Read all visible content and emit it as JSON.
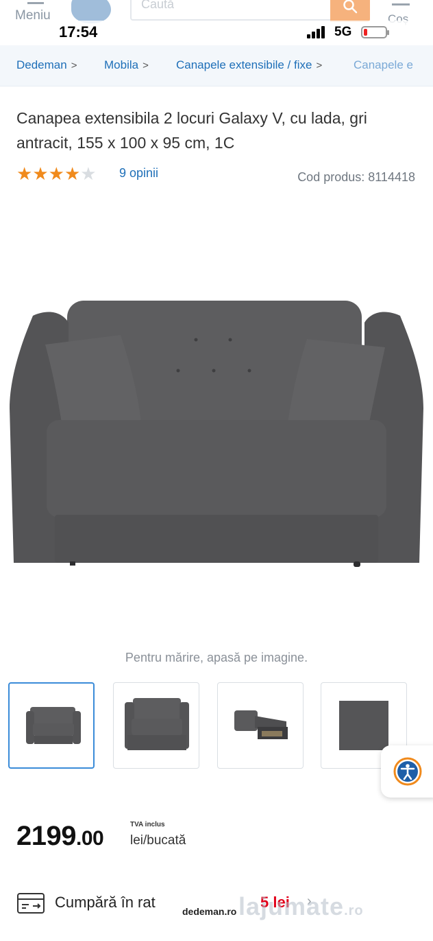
{
  "header": {
    "menu_label": "Meniu",
    "search_placeholder": "Caută",
    "cart_label": "Coș"
  },
  "status_bar": {
    "time": "17:54",
    "network": "5G"
  },
  "breadcrumb": [
    "Dedeman",
    "Mobila",
    "Canapele extensibile / fixe",
    "Canapele e"
  ],
  "product": {
    "title": "Canapea extensibila 2 locuri Galaxy V, cu lada, gri antracit, 155 x 100 x 95 cm, 1C",
    "rating": 4,
    "rating_max": 5,
    "reviews_label": "9 opinii",
    "code_label": "Cod produs: 8114418",
    "zoom_hint": "Pentru mărire, apasă pe imagine.",
    "thumbnails": [
      "front-view",
      "front-view-2",
      "open-bed-view",
      "fabric-swatch"
    ],
    "price_int": "2199",
    "price_dec": ".00",
    "vat_label": "TVA inclus",
    "unit_label": "lei/bucată",
    "installments_label": "Cumpără în rat",
    "installments_amount": "5 lei"
  },
  "watermark": {
    "domain": "dedeman.ro",
    "brand": "lajumate",
    "tld": ".ro"
  },
  "colors": {
    "accent_blue": "#1e6fb8",
    "star_orange": "#f08a1c",
    "sofa_grey": "#5a5a5c",
    "search_orange": "#f6b27d"
  }
}
